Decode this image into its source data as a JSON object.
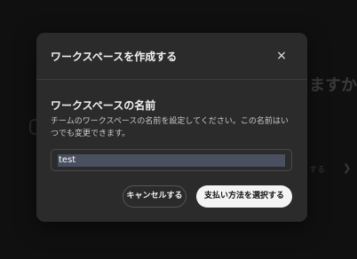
{
  "background": {
    "heading_fragment": "ますか",
    "side_text_fragment": "する"
  },
  "modal": {
    "title": "ワークスペースを作成する",
    "close_label": "×",
    "section_heading": "ワークスペースの名前",
    "section_description": "チームのワークスペースの名前を設定してください。この名前はいつでも変更できます。",
    "name_input_value": "test",
    "cancel_label": "キャンセルする",
    "primary_label": "支払い方法を選択する"
  },
  "colors": {
    "modal_background": "#2b2b2b",
    "primary_button": "#f4f4f4",
    "selection_highlight": "#4a5060"
  }
}
